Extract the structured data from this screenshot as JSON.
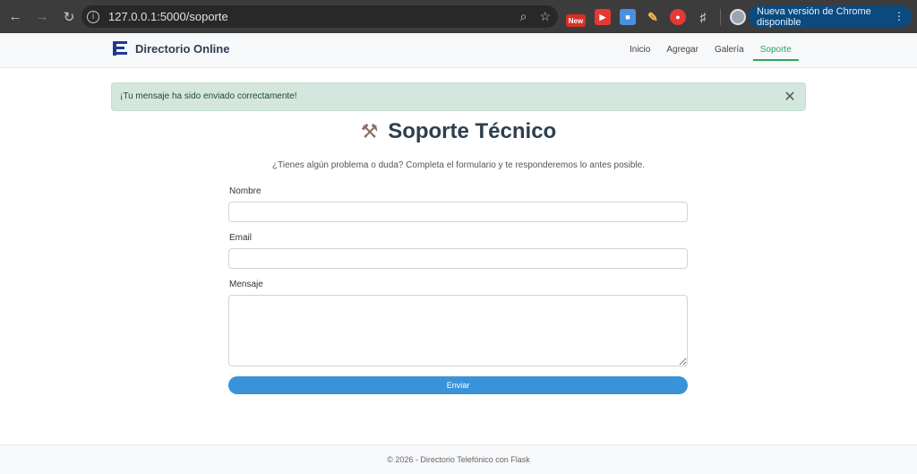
{
  "browser": {
    "url": "127.0.0.1:5000/soporte",
    "new_badge": "New",
    "update_label": "Nueva versión de Chrome disponible"
  },
  "navbar": {
    "brand": "Directorio Online",
    "links": [
      "Inicio",
      "Agregar",
      "Galería",
      "Soporte"
    ],
    "active": "Soporte",
    "accent_color": "#2ea55f"
  },
  "alert": {
    "message": "¡Tu mensaje ha sido enviado correctamente!",
    "close_icon": "close-icon"
  },
  "page": {
    "title": "Soporte Técnico",
    "title_icon": "hammer-and-wrench-icon",
    "subtitle": "¿Tienes algún problema o duda? Completa el formulario y te responderemos lo antes posible."
  },
  "form": {
    "nombre_label": "Nombre",
    "nombre_value": "",
    "email_label": "Email",
    "email_value": "",
    "mensaje_label": "Mensaje",
    "mensaje_value": "",
    "submit_label": "Enviar",
    "submit_color": "#3a93d8"
  },
  "footer": {
    "text": "© 2026 - Directorio Telefónico con Flask"
  }
}
